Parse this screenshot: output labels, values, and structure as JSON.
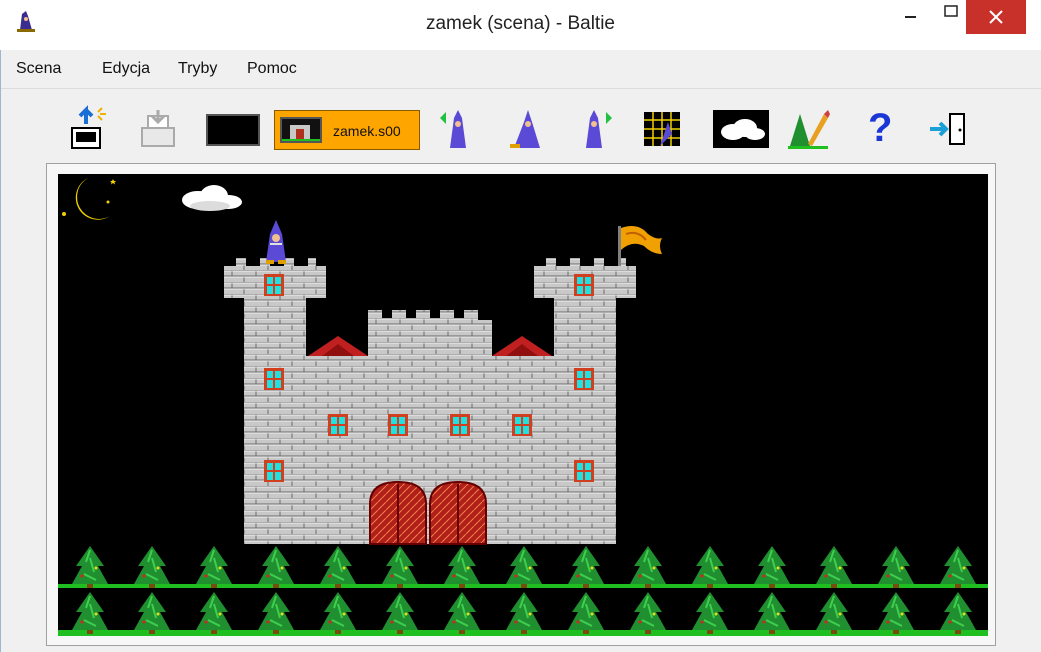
{
  "window": {
    "title": "zamek (scena) - Baltie"
  },
  "menu": {
    "items": [
      "Scena",
      "Edycja",
      "Tryby",
      "Pomoc"
    ]
  },
  "toolbar": {
    "scene_name": "zamek.s00",
    "help_glyph": "?",
    "icons": [
      "new-scene-icon",
      "print-icon",
      "black-screen-icon",
      "scene-file-icon",
      "wizard-back-icon",
      "wizard-walk-icon",
      "wizard-forward-icon",
      "grid-edit-icon",
      "cloud-icon",
      "tree-pencil-icon",
      "help-icon",
      "exit-icon"
    ]
  },
  "colors": {
    "scene_button": "#ffa500",
    "close_button": "#c7312a",
    "scene_background": "#000000",
    "grass": "#1fbf1f"
  }
}
